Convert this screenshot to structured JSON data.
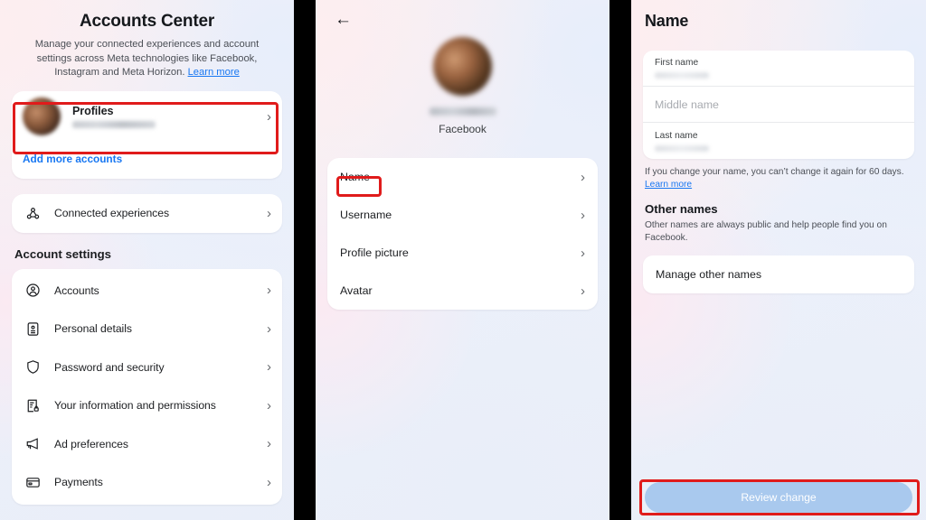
{
  "panel_accounts": {
    "title": "Accounts Center",
    "subtitle_line1": "Manage your connected experiences and account settings",
    "subtitle_line2": "across Meta technologies like Facebook, Instagram and",
    "subtitle_line3_pre": "Meta Horizon. ",
    "learn_more": "Learn more",
    "profiles_label": "Profiles",
    "profiles_name_redacted": "",
    "add_more_accounts": "Add more accounts",
    "connected_experiences": "Connected experiences",
    "section_header": "Account settings",
    "settings_items": [
      {
        "label": "Accounts",
        "icon": "account-circle-icon"
      },
      {
        "label": "Personal details",
        "icon": "id-card-icon"
      },
      {
        "label": "Password and security",
        "icon": "shield-icon"
      },
      {
        "label": "Your information and permissions",
        "icon": "document-lock-icon"
      },
      {
        "label": "Ad preferences",
        "icon": "megaphone-icon"
      },
      {
        "label": "Payments",
        "icon": "credit-card-icon"
      }
    ],
    "chevron": "›",
    "highlight_color": "#e01b1b"
  },
  "panel_profile": {
    "back_icon": "←",
    "profile_name_redacted": "",
    "platform": "Facebook",
    "menu_items": [
      {
        "label": "Name"
      },
      {
        "label": "Username"
      },
      {
        "label": "Profile picture"
      },
      {
        "label": "Avatar"
      }
    ],
    "chevron": "›",
    "highlighted_item": "Name"
  },
  "panel_name": {
    "title": "Name",
    "fields": [
      {
        "label": "First name",
        "type": "filled-redacted",
        "placeholder": ""
      },
      {
        "label": "",
        "type": "placeholder",
        "placeholder": "Middle name"
      },
      {
        "label": "Last name",
        "type": "filled-redacted",
        "placeholder": ""
      }
    ],
    "note": "If you change your name, you can’t change it again for 60 days.",
    "note_link": "Learn more",
    "other_names_header": "Other names",
    "other_names_desc": "Other names are always public and help people find you on Facebook.",
    "manage_other_names": "Manage other names",
    "review_button": "Review change",
    "review_button_color": "#a9c9ee",
    "review_button_text_color": "#ffffff"
  },
  "theme": {
    "link_color": "#1877f2",
    "text_color": "#1c1e21",
    "muted_text_color": "#4b4f56",
    "card_bg": "#ffffff",
    "divider_bg": "#000000"
  }
}
